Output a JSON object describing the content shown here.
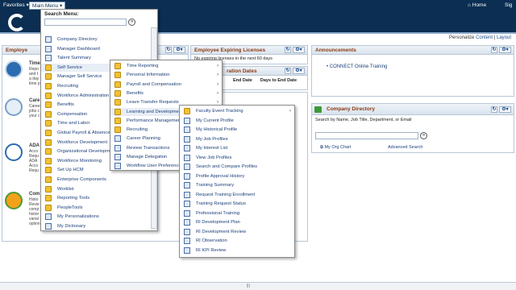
{
  "topbar": {
    "favorites": "Favorites",
    "main_menu": "Main Menu",
    "home": "Home",
    "signout": "Sig"
  },
  "personalize": {
    "label": "Personalize",
    "content": "Content",
    "sep": "|",
    "layout": "Layout"
  },
  "pagelets": {
    "employee": {
      "title": "Employe"
    },
    "licenses": {
      "title": "Employee Expiring Licenses",
      "body": "No expiring licenses in the next 60 days"
    },
    "registration": {
      "title": "ration Dates",
      "col1": "End Date",
      "col2": "Days to End Date"
    },
    "announcements": {
      "title": "Announcements",
      "item": "CONNECT Online Training"
    },
    "company_directory": {
      "title": "Company Directory",
      "search_label": "Search by Name, Job Title, Department, or Email",
      "org_chart": "My Org Chart",
      "advanced": "Advanced Search"
    }
  },
  "tiles": [
    {
      "title": "Time",
      "desc": [
        "Repo",
        "and t",
        "a day",
        "time p"
      ]
    },
    {
      "title": "Care",
      "desc": [
        "Caree",
        "jobs c",
        "your c"
      ]
    },
    {
      "title": "ADA",
      "desc": [
        "Acco",
        "Requ",
        "ADA",
        "Acco",
        "Requ"
      ]
    },
    {
      "title": "Com",
      "desc": [
        "Histo",
        "Revie",
        "comp",
        "histor",
        "varial",
        "option"
      ]
    }
  ],
  "menu1": {
    "search_label": "Search Menu:",
    "items": [
      {
        "label": "Company Directory",
        "icon": "doc-icon",
        "submenu": false
      },
      {
        "label": "Manager Dashboard",
        "icon": "doc-icon",
        "submenu": false
      },
      {
        "label": "Talent Summary",
        "icon": "doc-icon",
        "submenu": false
      },
      {
        "label": "Self Service",
        "icon": "folder-icon",
        "submenu": true
      },
      {
        "label": "Manager Self Service",
        "icon": "folder-icon",
        "submenu": true
      },
      {
        "label": "Recruiting",
        "icon": "folder-icon",
        "submenu": true
      },
      {
        "label": "Workforce Administration",
        "icon": "folder-icon",
        "submenu": true
      },
      {
        "label": "Benefits",
        "icon": "folder-icon",
        "submenu": true
      },
      {
        "label": "Compensation",
        "icon": "folder-icon",
        "submenu": true
      },
      {
        "label": "Time and Labor",
        "icon": "folder-icon",
        "submenu": true
      },
      {
        "label": "Global Payroll & Absence",
        "icon": "folder-icon",
        "submenu": true
      },
      {
        "label": "Workforce Development",
        "icon": "folder-icon",
        "submenu": true
      },
      {
        "label": "Organizational Development",
        "icon": "folder-icon",
        "submenu": true
      },
      {
        "label": "Workforce Monitoring",
        "icon": "folder-icon",
        "submenu": true
      },
      {
        "label": "Set Up HCM",
        "icon": "folder-icon",
        "submenu": true
      },
      {
        "label": "Enterprise Components",
        "icon": "folder-icon",
        "submenu": true
      },
      {
        "label": "Worklist",
        "icon": "folder-icon",
        "submenu": true
      },
      {
        "label": "Reporting Tools",
        "icon": "folder-icon",
        "submenu": true
      },
      {
        "label": "PeopleTools",
        "icon": "folder-icon",
        "submenu": true
      },
      {
        "label": "My Personalizations",
        "icon": "doc-icon",
        "submenu": false
      },
      {
        "label": "My Dictionary",
        "icon": "doc-icon",
        "submenu": false
      }
    ]
  },
  "menu2": {
    "items": [
      {
        "label": "Time Reporting",
        "icon": "folder-icon",
        "submenu": true
      },
      {
        "label": "Personal Information",
        "icon": "folder-icon",
        "submenu": true
      },
      {
        "label": "Payroll and Compensation",
        "icon": "folder-icon",
        "submenu": true
      },
      {
        "label": "Benefits",
        "icon": "folder-icon",
        "submenu": true
      },
      {
        "label": "Leave Transfer Requests",
        "icon": "folder-icon",
        "submenu": true
      },
      {
        "label": "Learning and Development",
        "icon": "folder-icon",
        "submenu": true
      },
      {
        "label": "Performance Management",
        "icon": "folder-icon",
        "submenu": true
      },
      {
        "label": "Recruiting",
        "icon": "folder-icon",
        "submenu": true
      },
      {
        "label": "Career Planning",
        "icon": "doc-icon",
        "submenu": false
      },
      {
        "label": "Review Transactions",
        "icon": "doc-icon",
        "submenu": false
      },
      {
        "label": "Manage Delegation",
        "icon": "doc-icon",
        "submenu": false
      },
      {
        "label": "Workflow User Preferences",
        "icon": "doc-icon",
        "submenu": false
      }
    ]
  },
  "menu3": {
    "items": [
      {
        "label": "Faculty Event Tracking",
        "icon": "folder-icon",
        "submenu": true
      },
      {
        "label": "My Current Profile",
        "icon": "doc-icon",
        "submenu": false
      },
      {
        "label": "My Historical Profile",
        "icon": "doc-icon",
        "submenu": false
      },
      {
        "label": "My Job Profiles",
        "icon": "doc-icon",
        "submenu": false
      },
      {
        "label": "My Interest List",
        "icon": "doc-icon",
        "submenu": false
      },
      {
        "label": "View Job Profiles",
        "icon": "doc-icon",
        "submenu": false
      },
      {
        "label": "Search and Compare Profiles",
        "icon": "doc-icon",
        "submenu": false
      },
      {
        "label": "Profile Approval History",
        "icon": "doc-icon",
        "submenu": false
      },
      {
        "label": "Training Summary",
        "icon": "doc-icon",
        "submenu": false
      },
      {
        "label": "Request Training Enrollment",
        "icon": "doc-icon",
        "submenu": false
      },
      {
        "label": "Training Request Status",
        "icon": "doc-icon",
        "submenu": false
      },
      {
        "label": "Professional Training",
        "icon": "doc-icon",
        "submenu": false
      },
      {
        "label": "RI Development Plan",
        "icon": "doc-icon",
        "submenu": false
      },
      {
        "label": "RI Development Review",
        "icon": "doc-icon",
        "submenu": false
      },
      {
        "label": "RI Observation",
        "icon": "doc-icon",
        "submenu": false
      },
      {
        "label": "RI KPI Review",
        "icon": "doc-icon",
        "submenu": false
      }
    ]
  },
  "colors": {
    "nav": "#0b2e52",
    "link": "#1b3f7a",
    "title": "#8a3a12",
    "folder": "#f1c232"
  }
}
